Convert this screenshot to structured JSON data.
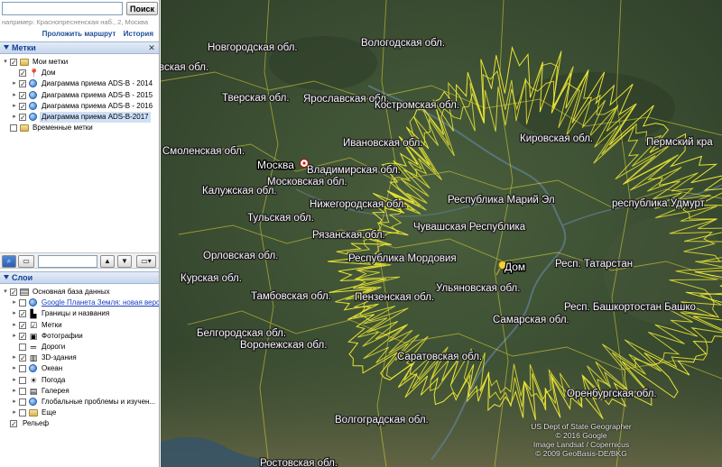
{
  "search": {
    "value": "",
    "button_label": "Поиск",
    "hint": "например: Краснопресненская наб., 2, Москва",
    "links": [
      "Проложить маршрут",
      "История"
    ]
  },
  "places_panel": {
    "title": "Метки",
    "items": [
      {
        "label": "Мои метки",
        "icon": "folder-icon",
        "checked": true,
        "indent": 0,
        "expander": "minus"
      },
      {
        "label": "Дом",
        "icon": "pushpin-icon",
        "checked": true,
        "indent": 1,
        "expander": ""
      },
      {
        "label": "Диаграмма приема ADS-B - 2014",
        "icon": "globe-icon",
        "checked": true,
        "indent": 1,
        "expander": "plus"
      },
      {
        "label": "Диаграмма приема ADS-B - 2015",
        "icon": "globe-icon",
        "checked": true,
        "indent": 1,
        "expander": "plus"
      },
      {
        "label": "Диаграмма приема ADS-B - 2016",
        "icon": "globe-icon",
        "checked": true,
        "indent": 1,
        "expander": "plus"
      },
      {
        "label": "Диаграмма приема ADS-B-2017",
        "icon": "globe-icon",
        "checked": true,
        "indent": 1,
        "expander": "plus",
        "selected": true
      },
      {
        "label": "Временные метки",
        "icon": "folder-icon",
        "checked": false,
        "indent": 0,
        "expander": ""
      }
    ]
  },
  "layers_panel": {
    "title": "Слои",
    "items": [
      {
        "label": "Основная база данных",
        "icon": "layers-icon",
        "checked": true,
        "indent": 0,
        "expander": "minus"
      },
      {
        "label": "Google Планета Земля: новая верси",
        "icon": "globe-icon",
        "checked": false,
        "indent": 1,
        "expander": "plus",
        "link": true
      },
      {
        "label": "Границы и названия",
        "icon": "borders-icon",
        "checked": true,
        "indent": 1,
        "expander": "plus"
      },
      {
        "label": "Метки",
        "icon": "checkbox-icon",
        "checked": true,
        "indent": 1,
        "expander": "plus"
      },
      {
        "label": "Фотографии",
        "icon": "camera-icon",
        "checked": true,
        "indent": 1,
        "expander": "plus"
      },
      {
        "label": "Дороги",
        "icon": "road-icon",
        "checked": false,
        "indent": 1,
        "expander": ""
      },
      {
        "label": "3D-здания",
        "icon": "building-icon",
        "checked": true,
        "indent": 1,
        "expander": "plus"
      },
      {
        "label": "Океан",
        "icon": "globe-icon",
        "checked": false,
        "indent": 1,
        "expander": "plus"
      },
      {
        "label": "Погода",
        "icon": "sun-icon",
        "checked": false,
        "indent": 1,
        "expander": "plus"
      },
      {
        "label": "Галерея",
        "icon": "gallery-icon",
        "checked": false,
        "indent": 1,
        "expander": "plus"
      },
      {
        "label": "Глобальные проблемы и изучен...",
        "icon": "globe-icon",
        "checked": false,
        "indent": 1,
        "expander": "plus"
      },
      {
        "label": "Еще",
        "icon": "folder-icon",
        "checked": false,
        "indent": 1,
        "expander": "plus"
      },
      {
        "label": "Рельеф",
        "icon": "",
        "checked": true,
        "indent": 0,
        "expander": ""
      }
    ]
  },
  "map": {
    "region_labels": [
      {
        "text": "Новгородская обл."
      },
      {
        "text": "Вологодская обл."
      },
      {
        "text": "вская обл."
      },
      {
        "text": "Тверская обл."
      },
      {
        "text": "Ярославская обл."
      },
      {
        "text": "Костромская обл."
      },
      {
        "text": "Кировская обл."
      },
      {
        "text": "Пермский кра"
      },
      {
        "text": "Смоленская обл."
      },
      {
        "text": "Ивановская обл."
      },
      {
        "text": "Владимирская обл."
      },
      {
        "text": "Московская обл."
      },
      {
        "text": "Калужская обл."
      },
      {
        "text": "Нижегородская обл."
      },
      {
        "text": "Республика Марий Эл"
      },
      {
        "text": "республика Удмурт"
      },
      {
        "text": "Тульская обл."
      },
      {
        "text": "Чувашская Республика"
      },
      {
        "text": "Рязанская обл."
      },
      {
        "text": "Орловская обл."
      },
      {
        "text": "Республика Мордовия"
      },
      {
        "text": "Респ. Татарстан"
      },
      {
        "text": "Курская обл."
      },
      {
        "text": "Тамбовская обл."
      },
      {
        "text": "Пензенская обл."
      },
      {
        "text": "Ульяновская обл."
      },
      {
        "text": "Респ. Башкортостан Башко"
      },
      {
        "text": "Самарская обл."
      },
      {
        "text": "Белгородская обл."
      },
      {
        "text": "Воронежская обл."
      },
      {
        "text": "Саратовская обл."
      },
      {
        "text": "Оренбургская обл."
      },
      {
        "text": "Волгоградская обл."
      },
      {
        "text": "Ростовская обл."
      }
    ],
    "places": [
      {
        "text": "Москва",
        "icon": "star-icon"
      },
      {
        "text": "Дом",
        "icon": "pushpin-icon"
      }
    ],
    "credits": [
      "US Dept of State Geographer",
      "© 2016 Google",
      "Image Landsat / Copernicus",
      "© 2009 GeoBasis-DE/BKG"
    ],
    "colors": {
      "coverage_line": "#f2ec36",
      "border_line": "#e8dc3a",
      "river": "#5d7a86",
      "terrain": "#3d5233"
    }
  }
}
